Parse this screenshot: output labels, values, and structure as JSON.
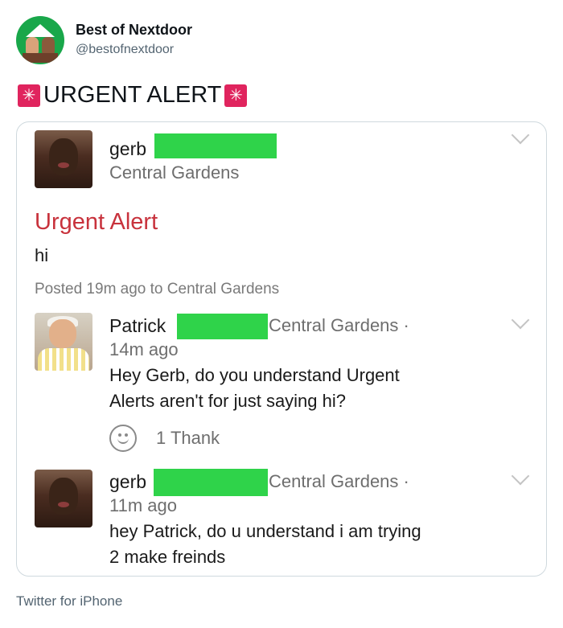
{
  "tweet": {
    "account_name": "Best of Nextdoor",
    "handle": "@bestofnextdoor",
    "text": "URGENT ALERT",
    "source": "Twitter for iPhone"
  },
  "post": {
    "author": "gerb",
    "location": "Central Gardens",
    "title": "Urgent Alert",
    "body": "hi",
    "posted": "Posted 19m ago to Central Gardens"
  },
  "comments": [
    {
      "author": "Patrick",
      "location": "Central Gardens ·",
      "time": "14m ago",
      "line1": "Hey Gerb, do you understand Urgent",
      "line2": "Alerts aren't for just saying hi?",
      "thanks": "1 Thank"
    },
    {
      "author": "gerb",
      "location": "Central Gardens ·",
      "time": "11m ago",
      "line1": "hey Patrick, do u understand i am trying",
      "line2": "2 make freinds"
    }
  ],
  "icons": {
    "alert": "rotating-light-emoji",
    "menu": "chevron-down-icon",
    "reaction": "smiley-icon"
  },
  "colors": {
    "alert_red": "#c8323c",
    "redaction_green": "#2fd34a"
  }
}
